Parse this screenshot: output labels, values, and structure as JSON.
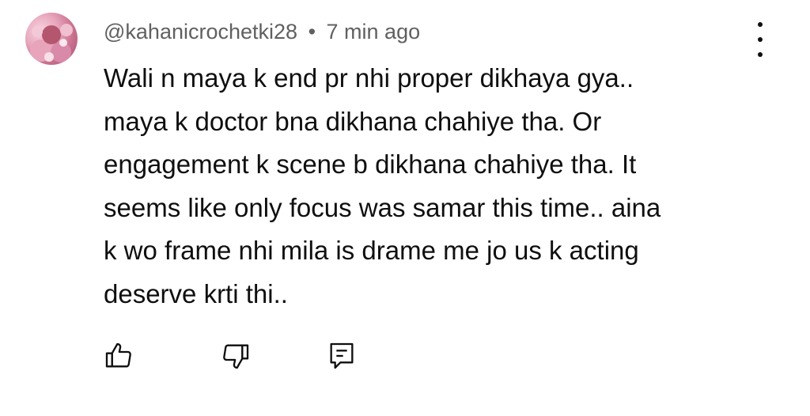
{
  "comment": {
    "author": "@kahanicrochetki28",
    "separator": "•",
    "time": "7 min ago",
    "lines": [
      "Wali n maya k end pr nhi proper dikhaya gya..",
      "maya k doctor bna dikhana chahiye tha. Or",
      "engagement k scene b dikhana chahiye tha. It",
      "seems like only focus was samar this time.. aina",
      "k wo frame nhi mila is drame me jo us k acting",
      "deserve krti thi.."
    ]
  },
  "icons": {
    "avatar": "profile-avatar",
    "more": "more-vertical-icon",
    "like": "thumbs-up-icon",
    "dislike": "thumbs-down-icon",
    "reply": "reply-comment-icon"
  }
}
